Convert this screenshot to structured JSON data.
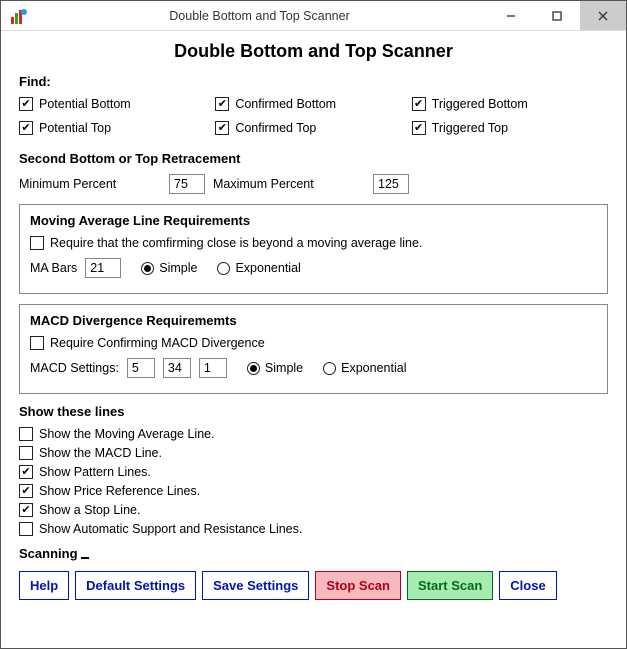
{
  "window": {
    "title": "Double Bottom and Top Scanner"
  },
  "header": "Double Bottom and Top Scanner",
  "find": {
    "label": "Find:",
    "pb": "Potential Bottom",
    "cb": "Confirmed Bottom",
    "tb": "Triggered Bottom",
    "pt": "Potential Top",
    "ct": "Confirmed Top",
    "tt": "Triggered Top"
  },
  "retr": {
    "label": "Second Bottom or Top Retracement",
    "min_label": "Minimum Percent",
    "min": "75",
    "max_label": "Maximum Percent",
    "max": "125"
  },
  "ma": {
    "title": "Moving Average Line Requirements",
    "req": "Require that the comfirming close is beyond a moving average line.",
    "bars_label": "MA Bars",
    "bars": "21",
    "simple": "Simple",
    "exp": "Exponential"
  },
  "macd": {
    "title": "MACD Divergence Requirememts",
    "req": "Require Confirming MACD Divergence",
    "set_label": "MACD Settings:",
    "s1": "5",
    "s2": "34",
    "s3": "1",
    "simple": "Simple",
    "exp": "Exponential"
  },
  "lines": {
    "title": "Show these lines",
    "l1": "Show the Moving Average Line.",
    "l2": "Show the MACD Line.",
    "l3": "Show Pattern Lines.",
    "l4": "Show Price Reference Lines.",
    "l5": "Show a Stop Line.",
    "l6": "Show Automatic Support and Resistance Lines."
  },
  "scanning": "Scanning",
  "buttons": {
    "help": "Help",
    "defaults": "Default Settings",
    "save": "Save Settings",
    "stop": "Stop Scan",
    "start": "Start Scan",
    "close": "Close"
  }
}
